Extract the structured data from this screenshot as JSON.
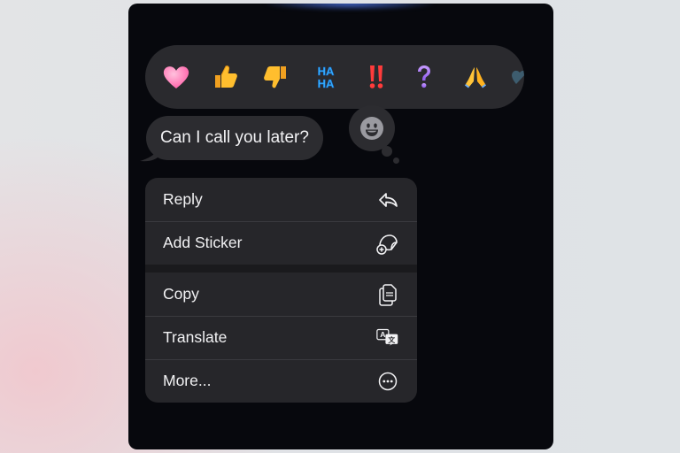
{
  "reactions": {
    "items": [
      {
        "name": "heart",
        "glyph": "❤️"
      },
      {
        "name": "thumbs-up",
        "glyph": "👍"
      },
      {
        "name": "thumbs-down",
        "glyph": "👎"
      },
      {
        "name": "haha",
        "glyph": "HA HA"
      },
      {
        "name": "emphasis",
        "glyph": "‼️"
      },
      {
        "name": "question",
        "glyph": "?"
      },
      {
        "name": "folded-hands",
        "glyph": "🙏"
      }
    ]
  },
  "message": {
    "text": "Can I call you later?"
  },
  "menu": {
    "items": [
      {
        "label": "Reply",
        "icon": "reply-arrow-icon"
      },
      {
        "label": "Add Sticker",
        "icon": "add-sticker-icon"
      },
      {
        "label": "Copy",
        "icon": "copy-icon"
      },
      {
        "label": "Translate",
        "icon": "translate-icon"
      },
      {
        "label": "More...",
        "icon": "more-ellipsis-icon"
      }
    ]
  },
  "colors": {
    "panel": "#07080d",
    "surface": "#26262a",
    "text": "#f2f2f4"
  }
}
